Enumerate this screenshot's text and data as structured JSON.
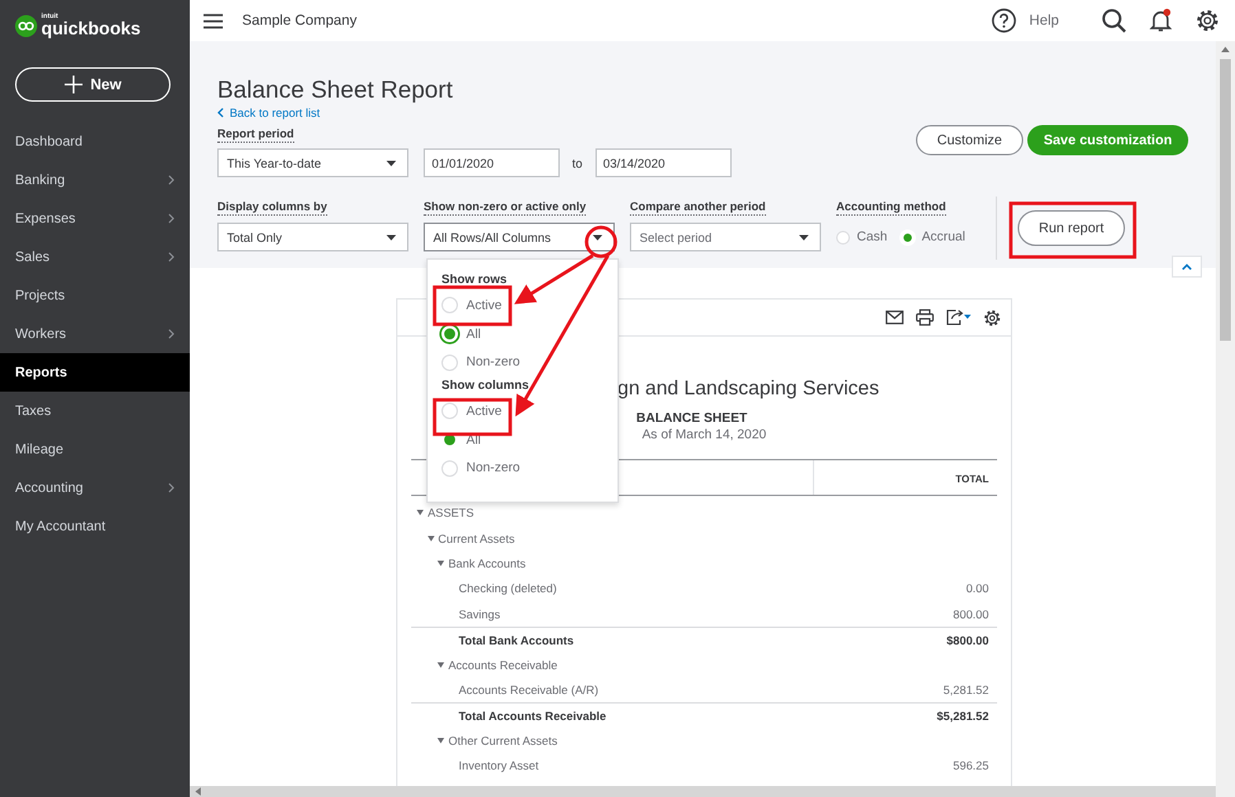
{
  "sidebar": {
    "logo_small": "intuit",
    "logo": "quickbooks",
    "new_button": "New",
    "items": [
      {
        "label": "Dashboard",
        "selected": false,
        "submenu": false
      },
      {
        "label": "Banking",
        "selected": false,
        "submenu": true
      },
      {
        "label": "Expenses",
        "selected": false,
        "submenu": true
      },
      {
        "label": "Sales",
        "selected": false,
        "submenu": true
      },
      {
        "label": "Projects",
        "selected": false,
        "submenu": false
      },
      {
        "label": "Workers",
        "selected": false,
        "submenu": true
      },
      {
        "label": "Reports",
        "selected": true,
        "submenu": false
      },
      {
        "label": "Taxes",
        "selected": false,
        "submenu": false
      },
      {
        "label": "Mileage",
        "selected": false,
        "submenu": false
      },
      {
        "label": "Accounting",
        "selected": false,
        "submenu": true
      },
      {
        "label": "My Accountant",
        "selected": false,
        "submenu": false
      }
    ]
  },
  "topbar": {
    "company": "Sample Company",
    "help": "Help",
    "notification": true
  },
  "header": {
    "title": "Balance Sheet Report",
    "back_link": "Back to report list",
    "customize": "Customize",
    "save": "Save customization",
    "run": "Run report"
  },
  "filters": {
    "report_period": {
      "label": "Report period",
      "value": "This Year-to-date",
      "from": "01/01/2020",
      "to_label": "to",
      "to": "03/14/2020"
    },
    "display_columns": {
      "label": "Display columns by",
      "value": "Total Only"
    },
    "non_zero": {
      "label": "Show non-zero or active only",
      "value": "All Rows/All Columns",
      "open": true
    },
    "compare": {
      "label": "Compare another period",
      "placeholder": "Select period"
    },
    "accounting_method": {
      "label": "Accounting method",
      "options": [
        {
          "label": "Cash",
          "selected": false
        },
        {
          "label": "Accrual",
          "selected": true
        }
      ]
    }
  },
  "dropdown": {
    "sections": [
      {
        "title": "Show rows",
        "options": [
          {
            "label": "Active",
            "selected": false
          },
          {
            "label": "All",
            "selected": true
          },
          {
            "label": "Non-zero",
            "selected": false
          }
        ]
      },
      {
        "title": "Show columns",
        "options": [
          {
            "label": "Active",
            "selected": false
          },
          {
            "label": "All",
            "selected": true
          },
          {
            "label": "Non-zero",
            "selected": false
          }
        ]
      }
    ]
  },
  "report": {
    "company": "gn and Landscaping Services",
    "title": "BALANCE SHEET",
    "date": "As of March 14, 2020",
    "column": "TOTAL",
    "rows": [
      {
        "label": "ASSETS",
        "expanded": true,
        "children": [
          {
            "label": "Current Assets",
            "expanded": true,
            "children": [
              {
                "label": "Bank Accounts",
                "expanded": true,
                "children": [
                  {
                    "label": "Checking (deleted)",
                    "amount": "0.00"
                  },
                  {
                    "label": "Savings",
                    "amount": "800.00"
                  }
                ],
                "total": {
                  "label": "Total Bank Accounts",
                  "amount": "$800.00"
                }
              },
              {
                "label": "Accounts Receivable",
                "expanded": true,
                "children": [
                  {
                    "label": "Accounts Receivable (A/R)",
                    "amount": "5,281.52"
                  }
                ],
                "total": {
                  "label": "Total Accounts Receivable",
                  "amount": "$5,281.52"
                }
              },
              {
                "label": "Other Current Assets",
                "expanded": true,
                "children": [
                  {
                    "label": "Inventory Asset",
                    "amount": "596.25"
                  }
                ]
              }
            ]
          }
        ]
      }
    ]
  }
}
